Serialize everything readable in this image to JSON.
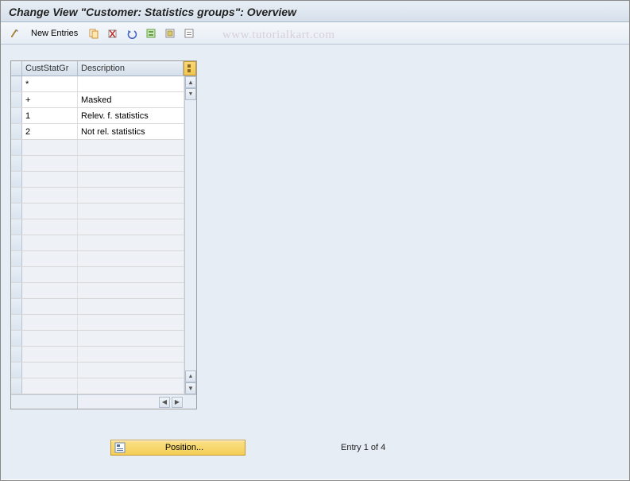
{
  "title": "Change View \"Customer: Statistics groups\": Overview",
  "toolbar": {
    "new_entries_label": "New Entries"
  },
  "watermark": "www.tutorialkart.com",
  "table": {
    "headers": {
      "custstatgr": "CustStatGr",
      "description": "Description"
    },
    "rows": [
      {
        "code": "*",
        "desc": ""
      },
      {
        "code": "+",
        "desc": "Masked"
      },
      {
        "code": "1",
        "desc": "Relev. f. statistics"
      },
      {
        "code": "2",
        "desc": "Not rel. statistics"
      },
      {
        "code": "",
        "desc": ""
      },
      {
        "code": "",
        "desc": ""
      },
      {
        "code": "",
        "desc": ""
      },
      {
        "code": "",
        "desc": ""
      },
      {
        "code": "",
        "desc": ""
      },
      {
        "code": "",
        "desc": ""
      },
      {
        "code": "",
        "desc": ""
      },
      {
        "code": "",
        "desc": ""
      },
      {
        "code": "",
        "desc": ""
      },
      {
        "code": "",
        "desc": ""
      },
      {
        "code": "",
        "desc": ""
      },
      {
        "code": "",
        "desc": ""
      },
      {
        "code": "",
        "desc": ""
      },
      {
        "code": "",
        "desc": ""
      },
      {
        "code": "",
        "desc": ""
      },
      {
        "code": "",
        "desc": ""
      }
    ]
  },
  "footer": {
    "position_label": "Position...",
    "entry_text": "Entry 1 of 4"
  }
}
